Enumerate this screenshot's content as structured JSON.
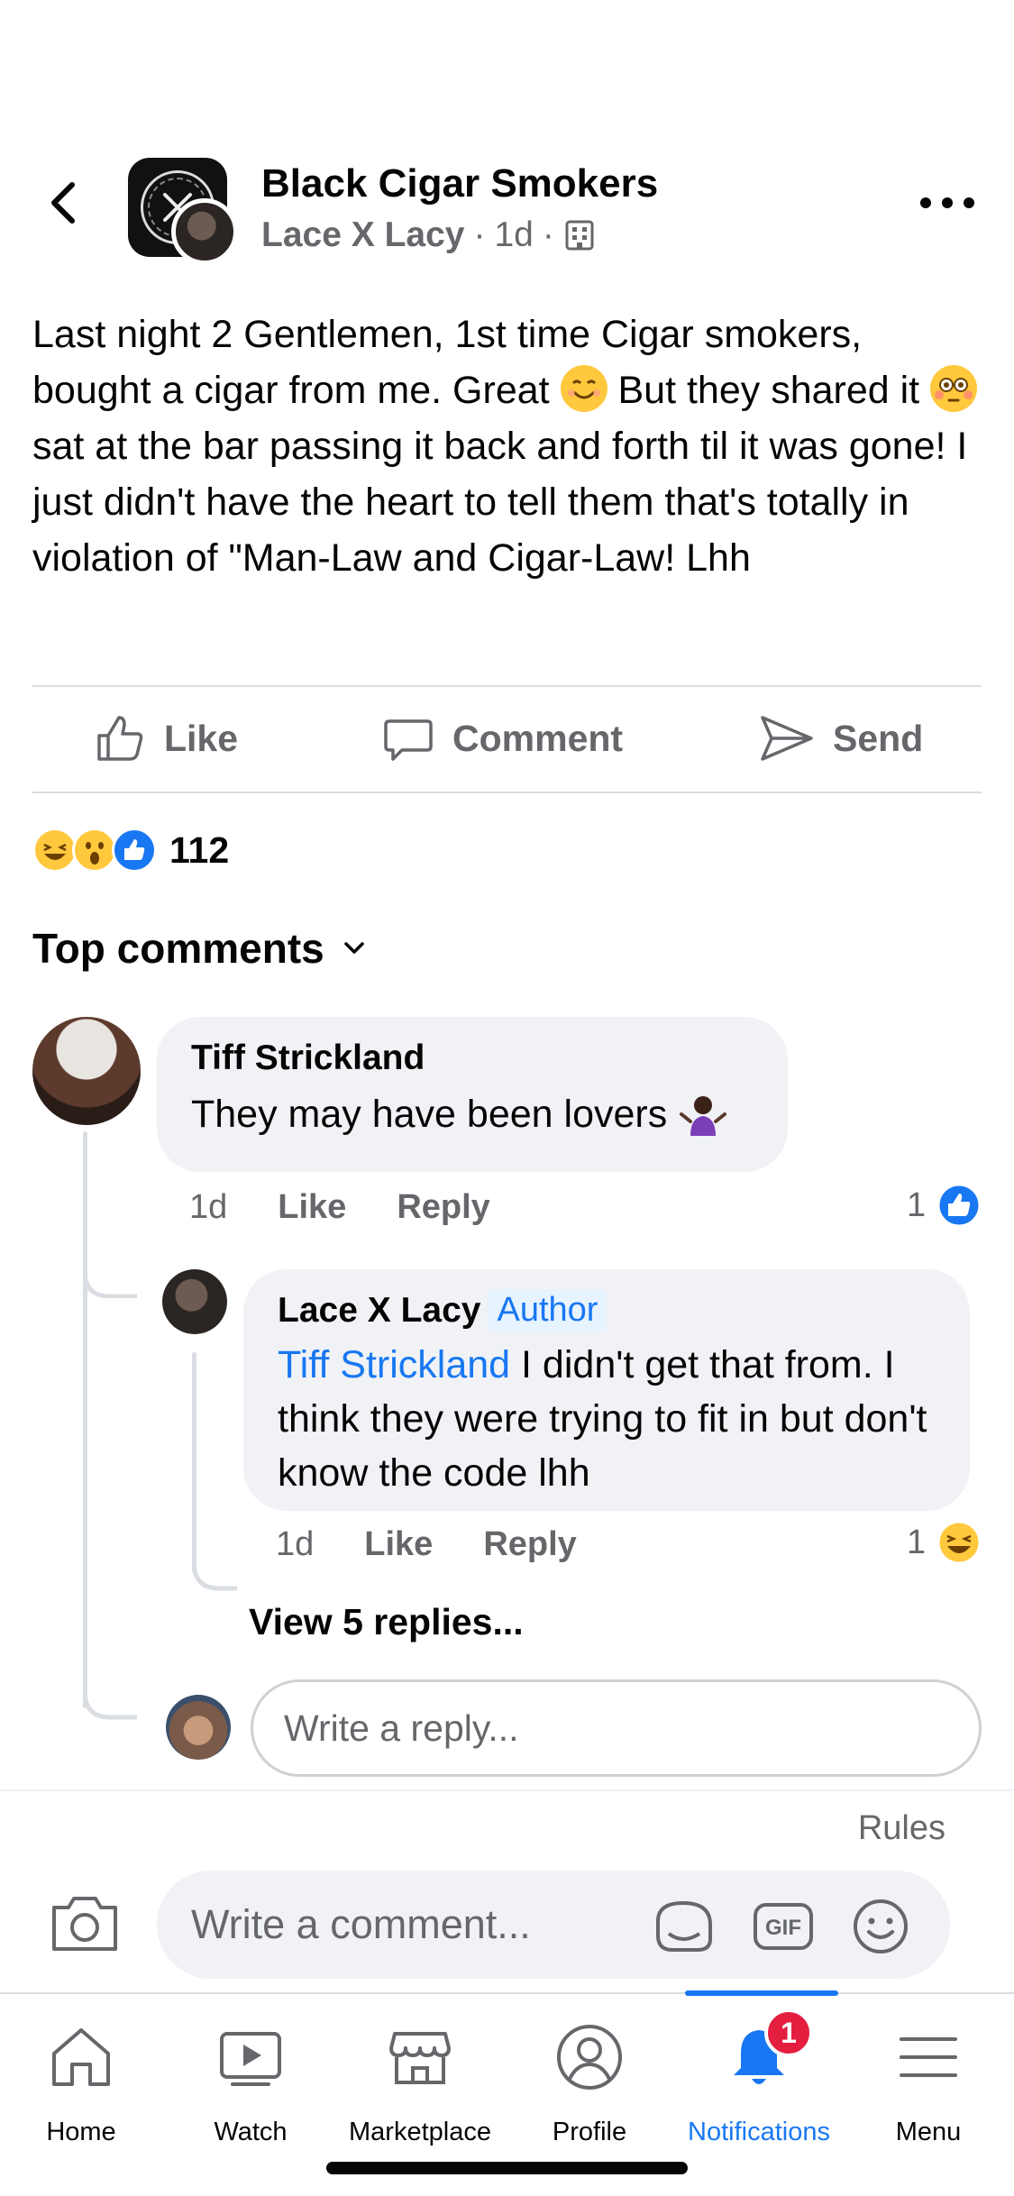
{
  "post": {
    "group_name": "Black Cigar Smokers",
    "author": "Lace X Lacy",
    "time": "1d",
    "separator": "·",
    "text_parts": [
      "Last night 2 Gentlemen, 1st time Cigar smokers, bought a cigar from me. Great ",
      " But they shared it ",
      " sat at the bar passing it back and forth til it was gone! I just didn't have the heart to tell them that's totally in violation of \"Man-Law and Cigar-Law! Lhh"
    ]
  },
  "actions": {
    "like": "Like",
    "comment": "Comment",
    "send": "Send"
  },
  "reactions": {
    "count": "112",
    "icons": [
      "haha-icon",
      "wow-icon",
      "like-icon"
    ]
  },
  "comments_header": "Top comments",
  "comments": [
    {
      "name": "Tiff Strickland",
      "text": "They may have been lovers",
      "time": "1d",
      "like": "Like",
      "reply": "Reply",
      "reaction_count": "1"
    }
  ],
  "reply": {
    "name": "Lace X Lacy",
    "badge": "Author",
    "mention": "Tiff Strickland",
    "text": " I didn't get that from. I think they were trying to fit in but don't know the code lhh",
    "time": "1d",
    "like": "Like",
    "reply": "Reply",
    "reaction_count": "1"
  },
  "view_replies": "View 5 replies...",
  "reply_placeholder": "Write a reply...",
  "composer": {
    "rules": "Rules",
    "placeholder": "Write a comment..."
  },
  "tabs": [
    {
      "label": "Home",
      "icon": "home-icon"
    },
    {
      "label": "Watch",
      "icon": "watch-icon"
    },
    {
      "label": "Marketplace",
      "icon": "marketplace-icon"
    },
    {
      "label": "Profile",
      "icon": "profile-icon"
    },
    {
      "label": "Notifications",
      "icon": "bell-icon",
      "badge": "1"
    },
    {
      "label": "Menu",
      "icon": "menu-icon"
    }
  ],
  "colors": {
    "accent": "#1877f2",
    "secondary_text": "#65676b",
    "bubble": "#f0f2f5",
    "badge_red": "#e41e3f"
  }
}
